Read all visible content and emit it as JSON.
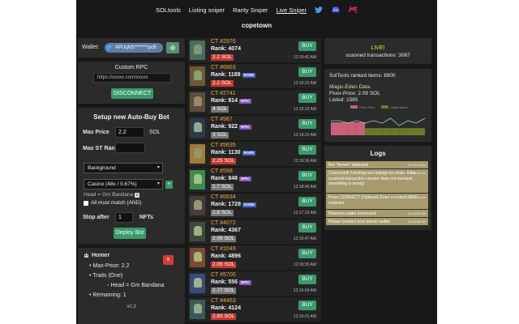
{
  "nav": {
    "links": [
      {
        "label": "SOLtools",
        "active": false
      },
      {
        "label": "Listing sniper",
        "active": false
      },
      {
        "label": "Rarity Sniper",
        "active": false
      },
      {
        "label": "Live Sniper",
        "active": true
      }
    ],
    "icons": [
      "twitter-icon",
      "discord-icon",
      "magic-eden-icon"
    ]
  },
  "title": "copetown",
  "wallet": {
    "label": "Wallet:",
    "address": "APUqNS*******pcB"
  },
  "rpc": {
    "title": "Custom RPC",
    "placeholder": "https://xxxxx.com/xxxxx",
    "button": "DISCONNECT"
  },
  "autobuy": {
    "heading": "Setup new Auto-Buy Bot",
    "max_price_label": "Max Price",
    "max_price_value": "2.2",
    "max_price_unit": "SOL",
    "max_rank_label": "Max ST Rank",
    "max_rank_value": "",
    "trait_type": "Background",
    "trait_value": "Casino (48x / 0.67%)",
    "selected_trait": "Head = Gm Bandana",
    "all_must_match": "All must match (AND)",
    "stop_after_label": "Stop after",
    "stop_after_value": "1",
    "stop_after_unit": "NFTs",
    "deploy_button": "Deploy Bot"
  },
  "bot": {
    "name": "Homer",
    "max_price": "Max-Price: 2.2",
    "traits": "Traits (One)",
    "trait": "Head = Gm Bandana",
    "remaining": "Remaining: 1",
    "version": "v0.3"
  },
  "listings": [
    {
      "ct": "CT #2976",
      "rank": "Rank: 4074",
      "badge": "",
      "price": "2.2 SOL",
      "price_color": "#c9392e",
      "time": "12:19:42 AM",
      "bg": "#4d6a5e",
      "face": "#7a9a72"
    },
    {
      "ct": "CT #6863",
      "rank": "Rank: 1189",
      "badge": "RARE",
      "price": "2.2 SOL",
      "price_color": "#c9392e",
      "time": "12:19:22 AM",
      "bg": "#6e5a36",
      "face": "#8aa06e"
    },
    {
      "ct": "CT #2741",
      "rank": "Rank: 814",
      "badge": "EPIC",
      "price": "4 SOL",
      "price_color": "#777777",
      "time": "12:19:12 AM",
      "bg": "#5b4e3c",
      "face": "#9a8a6a"
    },
    {
      "ct": "CT #987",
      "rank": "Rank: 922",
      "badge": "EPIC",
      "price": "3 SOL",
      "price_color": "#777777",
      "time": "12:19:22 AM",
      "bg": "#2b3b4c",
      "face": "#8fae88"
    },
    {
      "ct": "CT #5635",
      "rank": "Rank: 1130",
      "badge": "RARE",
      "price": "2.25 SOL",
      "price_color": "#c9392e",
      "time": "12:19:16 AM",
      "bg": "#a27a3e",
      "face": "#8e9a6a"
    },
    {
      "ct": "CT #598",
      "rank": "Rank: 848",
      "badge": "EPIC",
      "price": "2.7 SOL",
      "price_color": "#777777",
      "time": "12:18:46 AM",
      "bg": "#3f8a4a",
      "face": "#9fc288"
    },
    {
      "ct": "CT #6634",
      "rank": "Rank: 1728",
      "badge": "RARE",
      "price": "2.8 SOL",
      "price_color": "#777777",
      "time": "12:17:23 AM",
      "bg": "#4a3a3a",
      "face": "#8a9a76"
    },
    {
      "ct": "CT #4072",
      "rank": "Rank: 4367",
      "badge": "",
      "price": "2.99 SOL",
      "price_color": "#777777",
      "time": "12:16:47 AM",
      "bg": "#3d4b3c",
      "face": "#a0ae8a"
    },
    {
      "ct": "CT #1049",
      "rank": "Rank: 4896",
      "badge": "",
      "price": "2.05 SOL",
      "price_color": "#c9392e",
      "time": "12:16:33 AM",
      "bg": "#7a4a34",
      "face": "#a7b57c"
    },
    {
      "ct": "CT #5700",
      "rank": "Rank: 556",
      "badge": "EPIC",
      "price": "2.77 SOL",
      "price_color": "#777777",
      "time": "12:16:04 AM",
      "bg": "#3a4a7a",
      "face": "#9ab48a"
    },
    {
      "ct": "CT #4463",
      "rank": "Rank: 4124",
      "badge": "",
      "price": "2.83 SOL",
      "price_color": "#c9392e",
      "time": "12:16:01 AM",
      "bg": "#3a5a5a",
      "face": "#97a88a"
    }
  ],
  "buy_label": "BUY",
  "badge_colors": {
    "RARE": "#4b63c9",
    "EPIC": "#8a54c6"
  },
  "live": {
    "status": "LIVE!",
    "scanned": "scanned transactions: 3087"
  },
  "stats": {
    "ranked": "SolTools ranked items: 6900",
    "source": "Magic-Eden Data",
    "floor": "Floor-Price: 2.09 SOL",
    "listed": "Listed: 1585",
    "legend_floor": "Floor-Price",
    "legend_listed": "Listed items",
    "floor_series": [
      2.6,
      2.6,
      2.5,
      2.6,
      2.5,
      2.6,
      2.5,
      2.7,
      2.4,
      2.6,
      2.5,
      2.7
    ],
    "listed_series": [
      1,
      1,
      1,
      1,
      0.55,
      0.55,
      0.55,
      0.55,
      0.55,
      0.55,
      0.55,
      0.55
    ]
  },
  "logs": {
    "heading": "Logs",
    "entries": [
      {
        "text": "Bot \"Homer\" deployed",
        "time": "12:19:14 AM"
      },
      {
        "text": "Connected! Fetching new listings en-chain. If the scanned transaction counter does not increase, something is wrong!",
        "time": "12:18:53 AM"
      },
      {
        "text": "Press CONNECT (Optional) Enter a custom RPC endpoint",
        "time": "12:18:52 AM"
      },
      {
        "text": "Phantom wallet connected",
        "time": "12:18:52 AM"
      },
      {
        "text": "Please connect your burner wallet",
        "time": "12:18:36 AM"
      }
    ]
  }
}
